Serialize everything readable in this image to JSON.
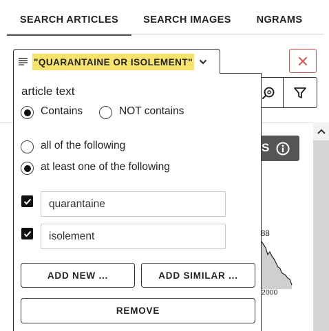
{
  "tabs": [
    {
      "label": "SEARCH ARTICLES",
      "active": true
    },
    {
      "label": "SEARCH IMAGES",
      "active": false
    },
    {
      "label": "NGRAMS",
      "active": false
    }
  ],
  "query_chip": {
    "query": "\"QUARANTAINE OR ISOLEMENT\"",
    "highlight_color": "#f7e36b",
    "icon": "lines-icon",
    "expand_icon": "chevron-down-icon"
  },
  "panel": {
    "field_label": "article text",
    "match_options": [
      {
        "label": "Contains",
        "selected": true
      },
      {
        "label": "NOT contains",
        "selected": false
      }
    ],
    "combine_options": [
      {
        "label": "all of the following",
        "selected": false
      },
      {
        "label": "at least one of the following",
        "selected": true
      }
    ],
    "terms": [
      {
        "value": "quarantaine",
        "checked": true
      },
      {
        "value": "isolement",
        "checked": true
      }
    ],
    "buttons": {
      "add_new": "ADD NEW ...",
      "add_similar": "ADD SIMILAR ...",
      "remove": "REMOVE"
    }
  },
  "background": {
    "close_icon": "close-icon",
    "close_color": "#d9534f",
    "dark_button_trailing_text": "S",
    "chart_peak_label": "88",
    "chart_tick_label": "2000"
  }
}
